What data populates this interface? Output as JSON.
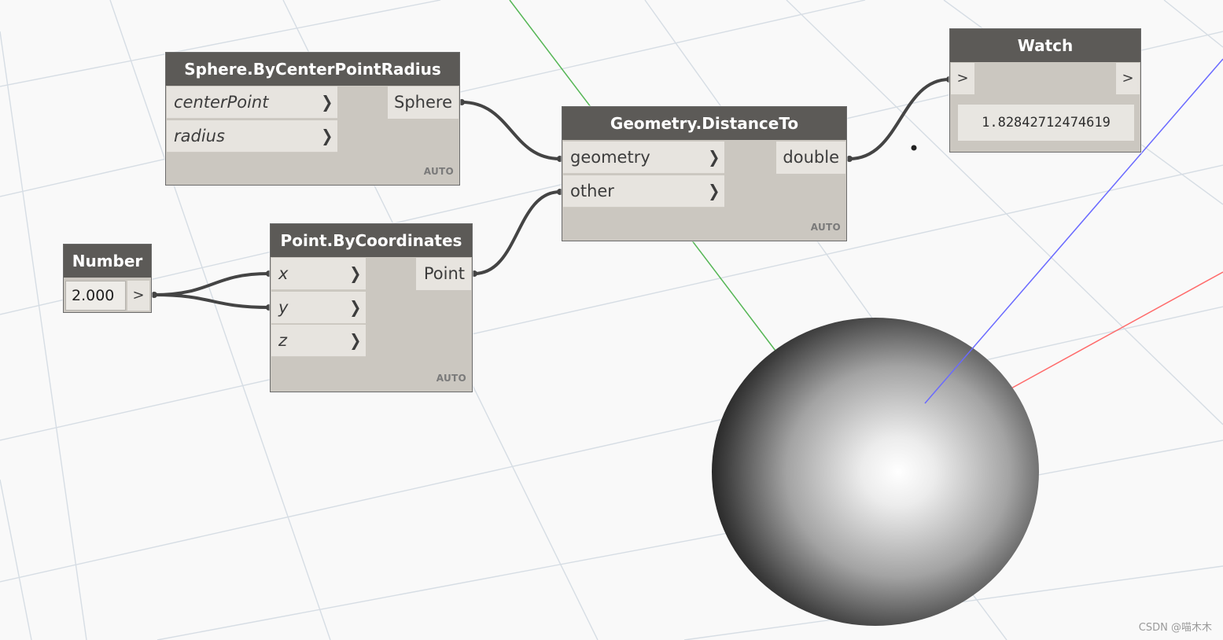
{
  "nodes": {
    "sphere": {
      "title": "Sphere.ByCenterPointRadius",
      "inputs": [
        "centerPoint",
        "radius"
      ],
      "output": "Sphere",
      "lacing": "AUTO"
    },
    "distance": {
      "title": "Geometry.DistanceTo",
      "inputs": [
        "geometry",
        "other"
      ],
      "output": "double",
      "lacing": "AUTO"
    },
    "watch": {
      "title": "Watch",
      "in_arrow": ">",
      "out_arrow": ">",
      "value": "1.82842712474619"
    },
    "number": {
      "title": "Number",
      "value": "2.000",
      "out_arrow": ">"
    },
    "point": {
      "title": "Point.ByCoordinates",
      "inputs": [
        "x",
        "y",
        "z"
      ],
      "output": "Point",
      "lacing": "AUTO"
    }
  },
  "port_chevron": "❯",
  "watermark": "CSDN @喵木木",
  "colors": {
    "node_header": "#5c5a57",
    "node_body": "#cbc7c0",
    "port_bg": "#e7e4df",
    "wire": "#444444",
    "axis_x": "#ff6a6a",
    "axis_y": "#55b655",
    "axis_z": "#6a6aff",
    "grid": "#d6dde4"
  },
  "icons": [
    "input-chevron-icon",
    "output-arrow-icon"
  ]
}
